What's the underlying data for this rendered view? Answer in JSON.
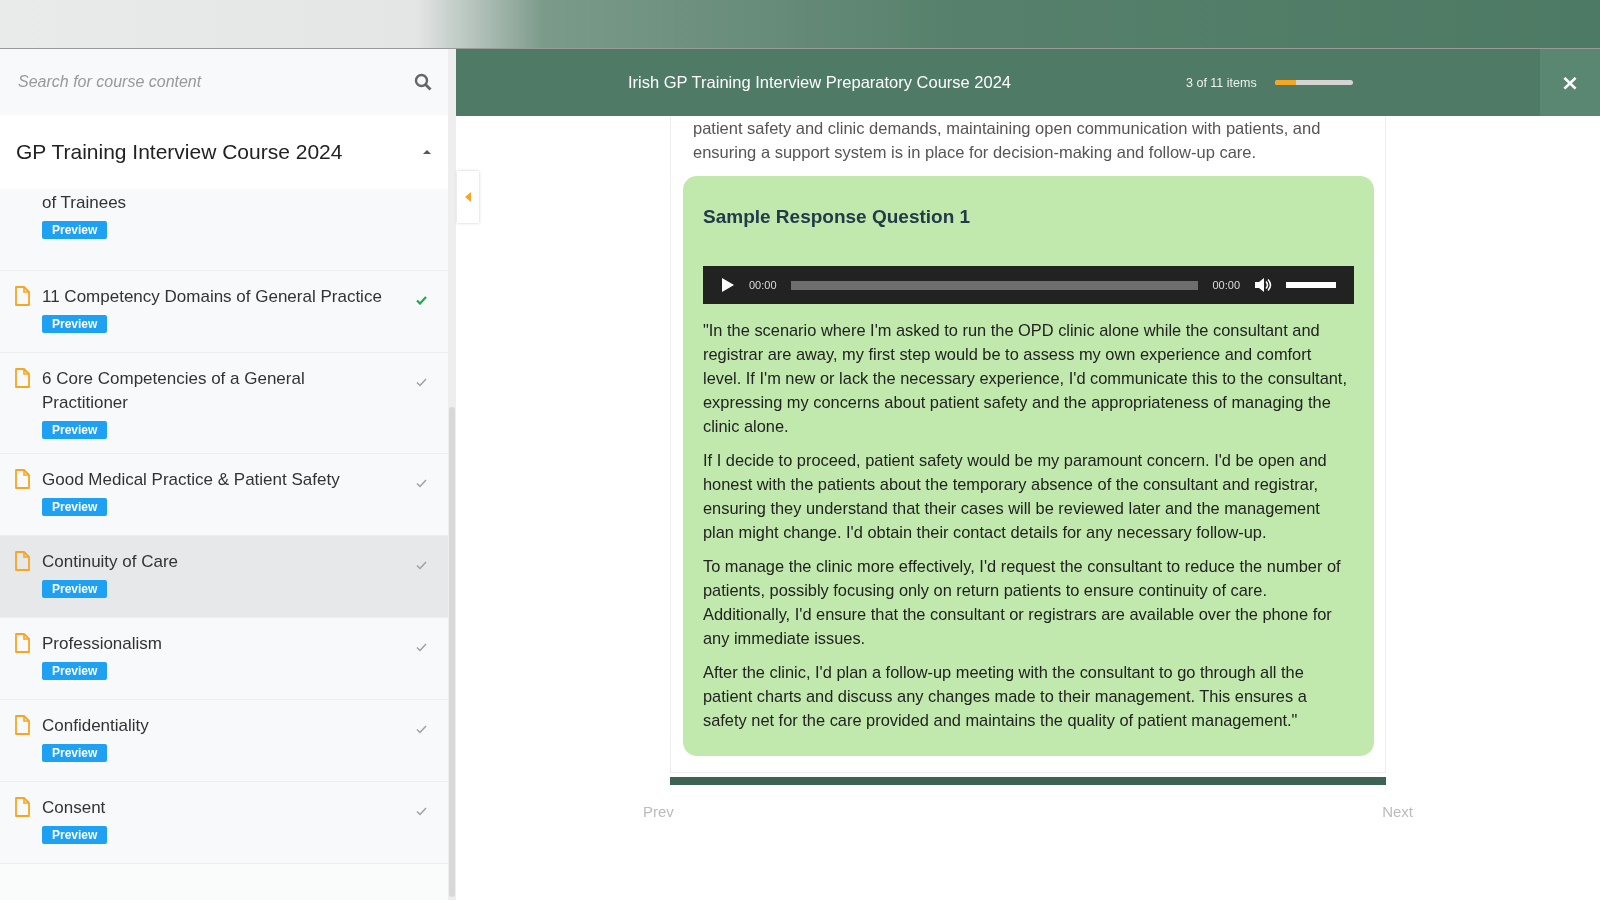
{
  "search": {
    "placeholder": "Search for course content"
  },
  "section": {
    "title": "GP Training Interview Course 2024",
    "expanded": true
  },
  "lessons": [
    {
      "kind": "partial",
      "title": "of Trainees",
      "badge": "Preview",
      "selected": false
    },
    {
      "kind": "lesson",
      "title": "11 Competency Domains of General Practice",
      "badge": "Preview",
      "completed": true,
      "selected": false
    },
    {
      "kind": "lesson",
      "title": "6 Core Competencies of a General Practitioner",
      "badge": "Preview",
      "completed": false,
      "selected": false
    },
    {
      "kind": "lesson",
      "title": "Good Medical Practice & Patient Safety",
      "badge": "Preview",
      "completed": false,
      "selected": false
    },
    {
      "kind": "lesson",
      "title": "Continuity of Care",
      "badge": "Preview",
      "completed": false,
      "selected": true
    },
    {
      "kind": "lesson",
      "title": "Professionalism",
      "badge": "Preview",
      "completed": false,
      "selected": false
    },
    {
      "kind": "lesson",
      "title": "Confidentiality",
      "badge": "Preview",
      "completed": false,
      "selected": false
    },
    {
      "kind": "lesson",
      "title": "Consent",
      "badge": "Preview",
      "completed": false,
      "selected": false
    }
  ],
  "header": {
    "title": "Irish GP Training Interview Preparatory Course 2024",
    "progress_text": "3 of 11 items",
    "level": 0.27,
    "close": "×"
  },
  "content": {
    "intro": "patient safety and clinic demands, maintaining open communication with patients, and ensuring a support system is in place for decision-making and follow-up care.",
    "card_title": "Sample Response Question 1",
    "player": {
      "current": "00:00",
      "duration": "00:00",
      "volume": {
        "level": 1
      }
    },
    "paragraphs": [
      "\"In the scenario where I'm asked to run the OPD clinic alone while the consultant and registrar are away, my first step would be to assess my own experience and comfort level. If I'm new or lack the necessary experience, I'd communicate this to the consultant, expressing my concerns about patient safety and the appropriateness of managing the clinic alone.",
      "If I decide to proceed, patient safety would be my paramount concern. I'd be open and honest with the patients about the temporary absence of the consultant and registrar, ensuring they understand that their cases will be reviewed later and the management plan might change. I'd obtain their contact details for any necessary follow-up.",
      "To manage the clinic more effectively, I'd request the consultant to reduce the number of patients, possibly focusing only on return patients to ensure continuity of care. Additionally, I'd ensure that the consultant or registrars are available over the phone for any immediate issues.",
      "After the clinic, I'd plan a follow-up meeting with the consultant to go through all the patient charts and discuss any changes made to their management. This ensures a safety net for the care provided and maintains the quality of patient management.\""
    ]
  },
  "nav": {
    "prev": "Prev",
    "next": "Next"
  }
}
